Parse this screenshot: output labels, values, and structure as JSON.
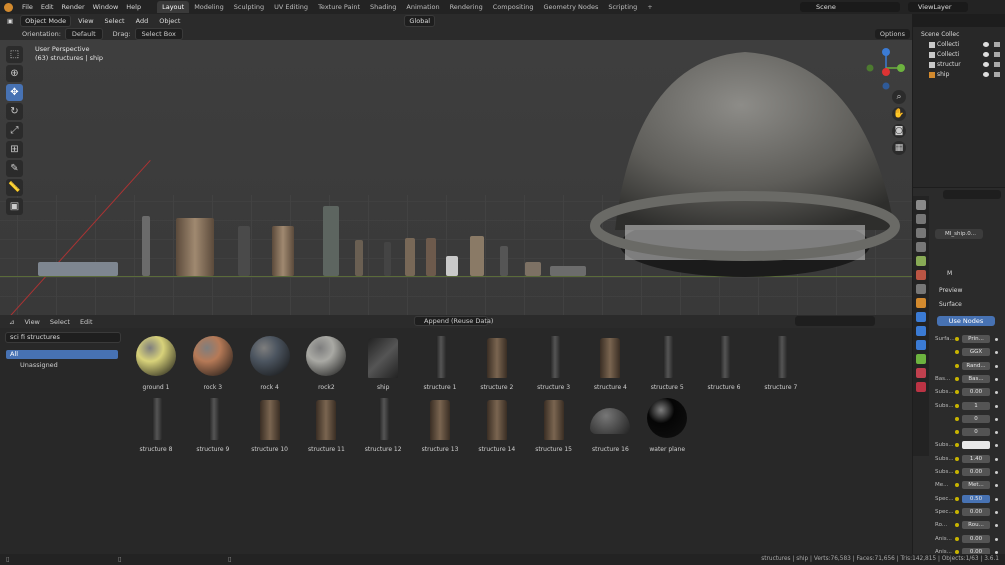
{
  "menu": [
    "File",
    "Edit",
    "Render",
    "Window",
    "Help"
  ],
  "workspaces": [
    {
      "label": "Layout",
      "active": true
    },
    {
      "label": "Modeling"
    },
    {
      "label": "Sculpting"
    },
    {
      "label": "UV Editing"
    },
    {
      "label": "Texture Paint"
    },
    {
      "label": "Shading"
    },
    {
      "label": "Animation"
    },
    {
      "label": "Rendering"
    },
    {
      "label": "Compositing"
    },
    {
      "label": "Geometry Nodes"
    },
    {
      "label": "Scripting"
    }
  ],
  "scene": "Scene",
  "view_layer": "ViewLayer",
  "viewport_header": {
    "mode": "Object Mode",
    "view": "View",
    "select": "Select",
    "add": "Add",
    "object": "Object",
    "transform": "Global",
    "options": "Options"
  },
  "tool_header": {
    "orientation_label": "Orientation:",
    "orientation": "Default",
    "drag_label": "Drag:",
    "drag": "Select Box"
  },
  "viewport_info": {
    "line1": "User Perspective",
    "line2": "(63) structures | ship"
  },
  "asset_browser": {
    "view": "View",
    "select": "Select",
    "edit": "Edit",
    "import_mode": "Append (Reuse Data)",
    "library": "sci fi structures",
    "categories": [
      "All",
      "Unassigned"
    ]
  },
  "assets": [
    {
      "name": "ground 1",
      "kind": "ball",
      "color": "#d8d27a"
    },
    {
      "name": "rock 3",
      "kind": "ball",
      "color": "#b67a57"
    },
    {
      "name": "rock 4",
      "kind": "ball",
      "color": "#4c5560"
    },
    {
      "name": "rock2",
      "kind": "ball",
      "color": "#a9a9a4"
    },
    {
      "name": "ship",
      "kind": "ship"
    },
    {
      "name": "structure 1",
      "kind": "stick"
    },
    {
      "name": "structure 2",
      "kind": "tower"
    },
    {
      "name": "structure 3",
      "kind": "stick"
    },
    {
      "name": "structure 4",
      "kind": "tower"
    },
    {
      "name": "structure 5",
      "kind": "stick"
    },
    {
      "name": "structure 6",
      "kind": "stick"
    },
    {
      "name": "structure 7",
      "kind": "stick"
    },
    {
      "name": "structure 8",
      "kind": "stick"
    },
    {
      "name": "structure 9",
      "kind": "stick"
    },
    {
      "name": "structure 10",
      "kind": "tower"
    },
    {
      "name": "structure 11",
      "kind": "tower"
    },
    {
      "name": "structure 12",
      "kind": "stick"
    },
    {
      "name": "structure 13",
      "kind": "tower"
    },
    {
      "name": "structure 14",
      "kind": "tower"
    },
    {
      "name": "structure 15",
      "kind": "tower"
    },
    {
      "name": "structure 16",
      "kind": "dome"
    },
    {
      "name": "water plane",
      "kind": "ball",
      "color": "#050505"
    }
  ],
  "outliner": {
    "title": "Scene Collec",
    "rows": [
      "Collecti",
      "Collecti",
      "structur",
      "ship"
    ]
  },
  "properties": {
    "material": "MI_ship.0...",
    "short": "M",
    "preview": "Preview",
    "surface": "Surface",
    "use_nodes": "Use Nodes",
    "rows": [
      {
        "label": "Surfa...",
        "value": "Prin..."
      },
      {
        "label": "",
        "value": "GGX"
      },
      {
        "label": "",
        "value": "Rand..."
      },
      {
        "label": "Bas...",
        "value": "Bas..."
      },
      {
        "label": "Subs...",
        "value": "0.00"
      },
      {
        "label": "Subs...",
        "value": "1"
      },
      {
        "label": "",
        "value": "0"
      },
      {
        "label": "",
        "value": "0"
      },
      {
        "label": "Subs...",
        "value": ""
      },
      {
        "label": "Subs...",
        "value": "1.40"
      },
      {
        "label": "Subs...",
        "value": "0.00"
      },
      {
        "label": "Me...",
        "value": "Met..."
      },
      {
        "label": "Spec...",
        "value": "0.50"
      },
      {
        "label": "Spec...",
        "value": "0.00"
      },
      {
        "label": "Ro...",
        "value": "Rou..."
      },
      {
        "label": "Anis...",
        "value": "0.00"
      },
      {
        "label": "Anis...",
        "value": "0.00"
      }
    ]
  },
  "status": "structures | ship | Verts:76,583 | Faces:71,656 | Tris:142,815 | Objects:1/63 | 3.6.1"
}
